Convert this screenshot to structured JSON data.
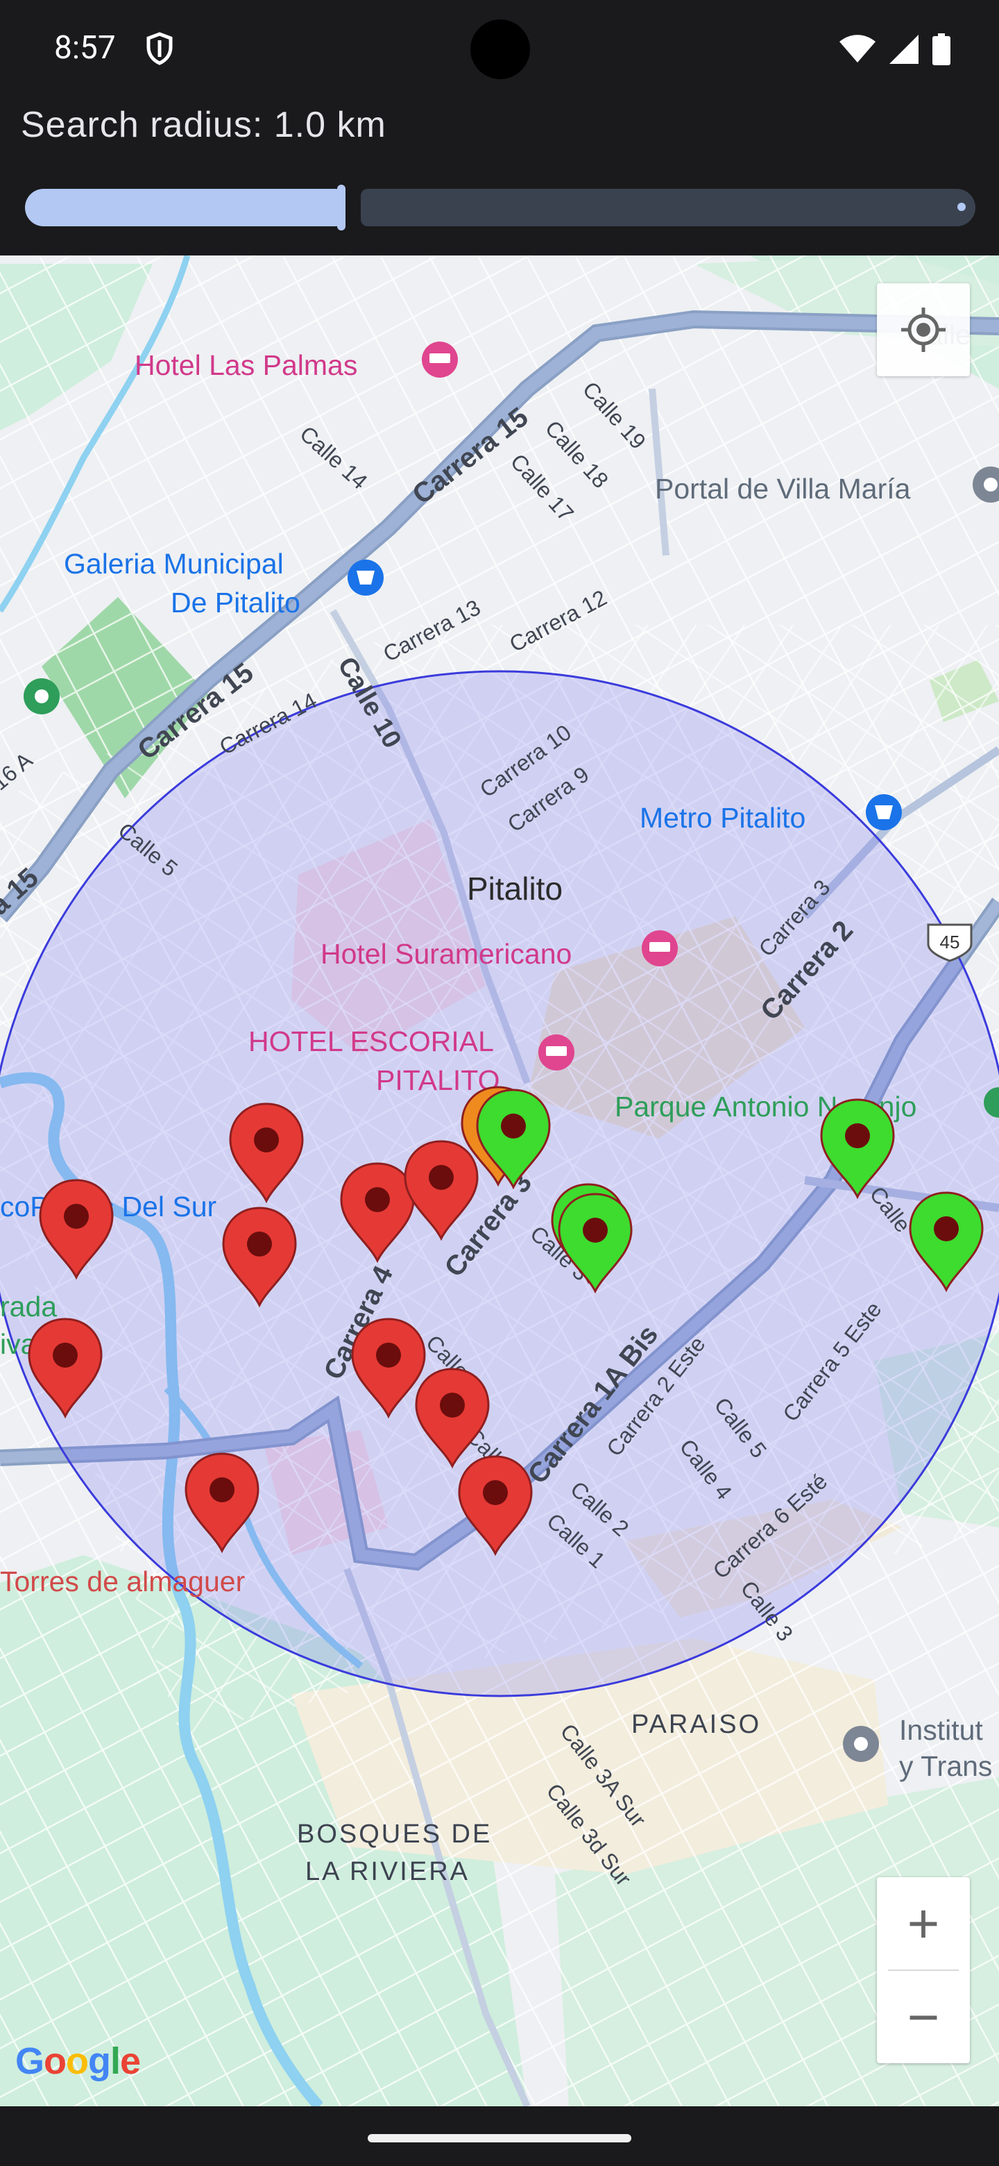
{
  "status_bar": {
    "time": "8:57"
  },
  "search": {
    "radius_label": "Search radius: 1.0 km",
    "radius_km": 1.0,
    "slider_fraction": 0.34
  },
  "map": {
    "city": "Pitalito",
    "pois": {
      "hotel_las_palmas": "Hotel Las Palmas",
      "galeria_line1": "Galeria Municipal",
      "galeria_line2": "De Pitalito",
      "portal": "Portal de Villa María",
      "metro": "Metro Pitalito",
      "hotel_suramericano": "Hotel Suramericano",
      "escorial_line1": "HOTEL ESCORIAL",
      "escorial_line2": "PITALITO",
      "parque": "Parque Antonio Naranjo",
      "plastic": "coPlastic Del Sur",
      "torres": "Torres de almaguer",
      "paraiso": "PARAISO",
      "bosques_line1": "BOSQUES DE",
      "bosques_line2": "LA RIVIERA",
      "instituto_line1": "Institut",
      "instituto_line2": "y Trans",
      "dorada_line1": "rada",
      "dorada_line2": "iva",
      "partial_calle": "alle"
    },
    "streets": {
      "carrera15_a": "Carrera 15",
      "carrera15_b": "Carrera 15",
      "carrera15_c": "a 15",
      "calle14": "Calle 14",
      "calle19": "Calle 19",
      "calle18": "Calle 18",
      "calle17": "Calle 17",
      "carrera13": "Carrera 13",
      "carrera12": "Carrera 12",
      "carrera14": "Carrera 14",
      "calle10": "Calle 10",
      "carrera10": "Carrera 10",
      "carrera9": "Carrera 9",
      "calle16a": "16 A",
      "calle5_w": "Calle 5",
      "carrera3_ne": "Carrera 3",
      "carrera2": "Carrera 2",
      "carrera3": "Carrera 3",
      "calle3_c": "Calle 3",
      "carrera4": "Carrera 4",
      "calle_c1": "Calle",
      "calle_c2": "Calle",
      "carrera1abis": "Carrera 1A Bis",
      "carrera2este": "Carrera 2 Este",
      "calle5": "Calle 5",
      "calle4": "Calle 4",
      "carrera5este": "Carrera 5 Este",
      "carrera6este": "Carrera 6 Esté",
      "calle2": "Calle 2",
      "calle1": "Calle 1",
      "calle3_s": "Calle 3",
      "calle3asur": "Calle 3A Sur",
      "calle3dsur": "Calle 3d Sur",
      "calle_e": "Calle",
      "route45": "45"
    },
    "circle_color": "#3b3bdc",
    "marker_colors": {
      "red": "#e53935",
      "green": "#3ddc2e",
      "orange": "#ef8a1f"
    }
  },
  "controls": {
    "zoom_in": "+",
    "zoom_out": "−"
  },
  "attribution": {
    "G": "G",
    "o1": "o",
    "o2": "o",
    "g": "g",
    "l": "l",
    "e": "e"
  }
}
